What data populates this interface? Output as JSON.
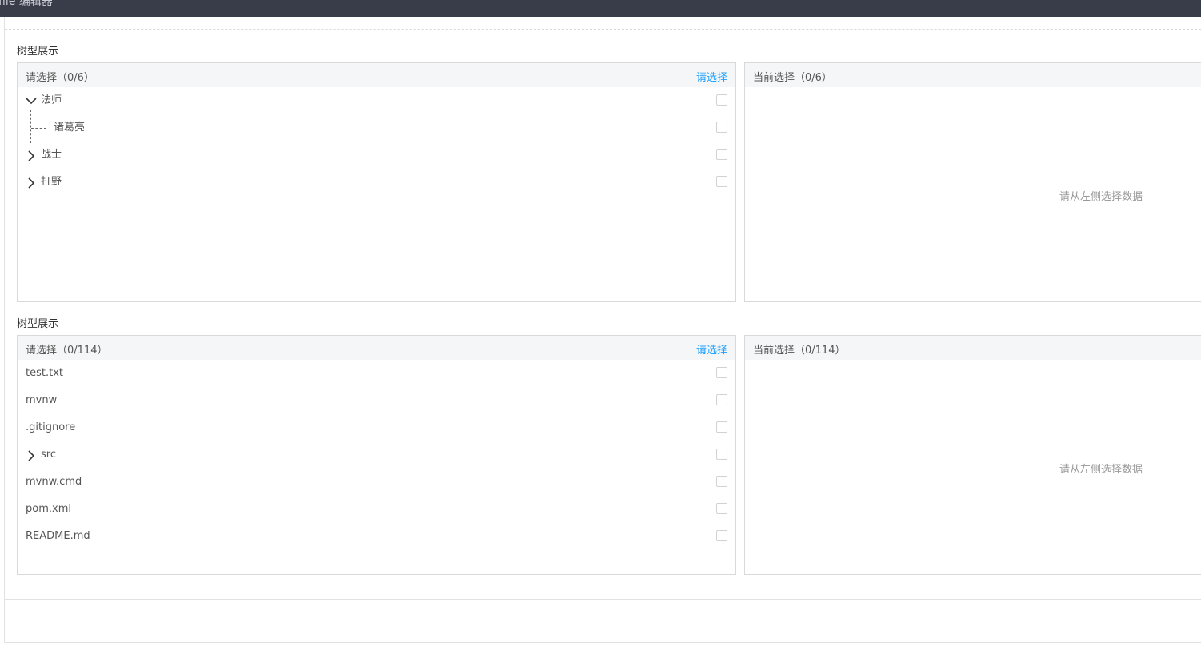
{
  "header": {
    "title": "file 编辑器"
  },
  "sections": [
    {
      "label": "树型展示",
      "left_panel": {
        "title": "请选择（0/6）",
        "action": "请选择",
        "items": [
          {
            "label": "法师",
            "expandable": true,
            "expanded": true
          },
          {
            "label": "诸葛亮",
            "child": true
          },
          {
            "label": "战士",
            "expandable": true,
            "expanded": false
          },
          {
            "label": "打野",
            "expandable": true,
            "expanded": false
          }
        ]
      },
      "right_panel": {
        "title": "当前选择（0/6）",
        "empty_text": "请从左侧选择数据"
      }
    },
    {
      "label": "树型展示",
      "left_panel": {
        "title": "请选择（0/114）",
        "action": "请选择",
        "items": [
          {
            "label": "test.txt"
          },
          {
            "label": "mvnw"
          },
          {
            "label": ".gitignore"
          },
          {
            "label": "src",
            "expandable": true,
            "expanded": false
          },
          {
            "label": "mvnw.cmd"
          },
          {
            "label": "pom.xml"
          },
          {
            "label": "README.md"
          }
        ]
      },
      "right_panel": {
        "title": "当前选择（0/114）",
        "empty_text": "请从左侧选择数据"
      }
    }
  ],
  "colors": {
    "topbar": "#393d49",
    "link": "#1e9fff",
    "panel_head": "#f5f6f7"
  }
}
